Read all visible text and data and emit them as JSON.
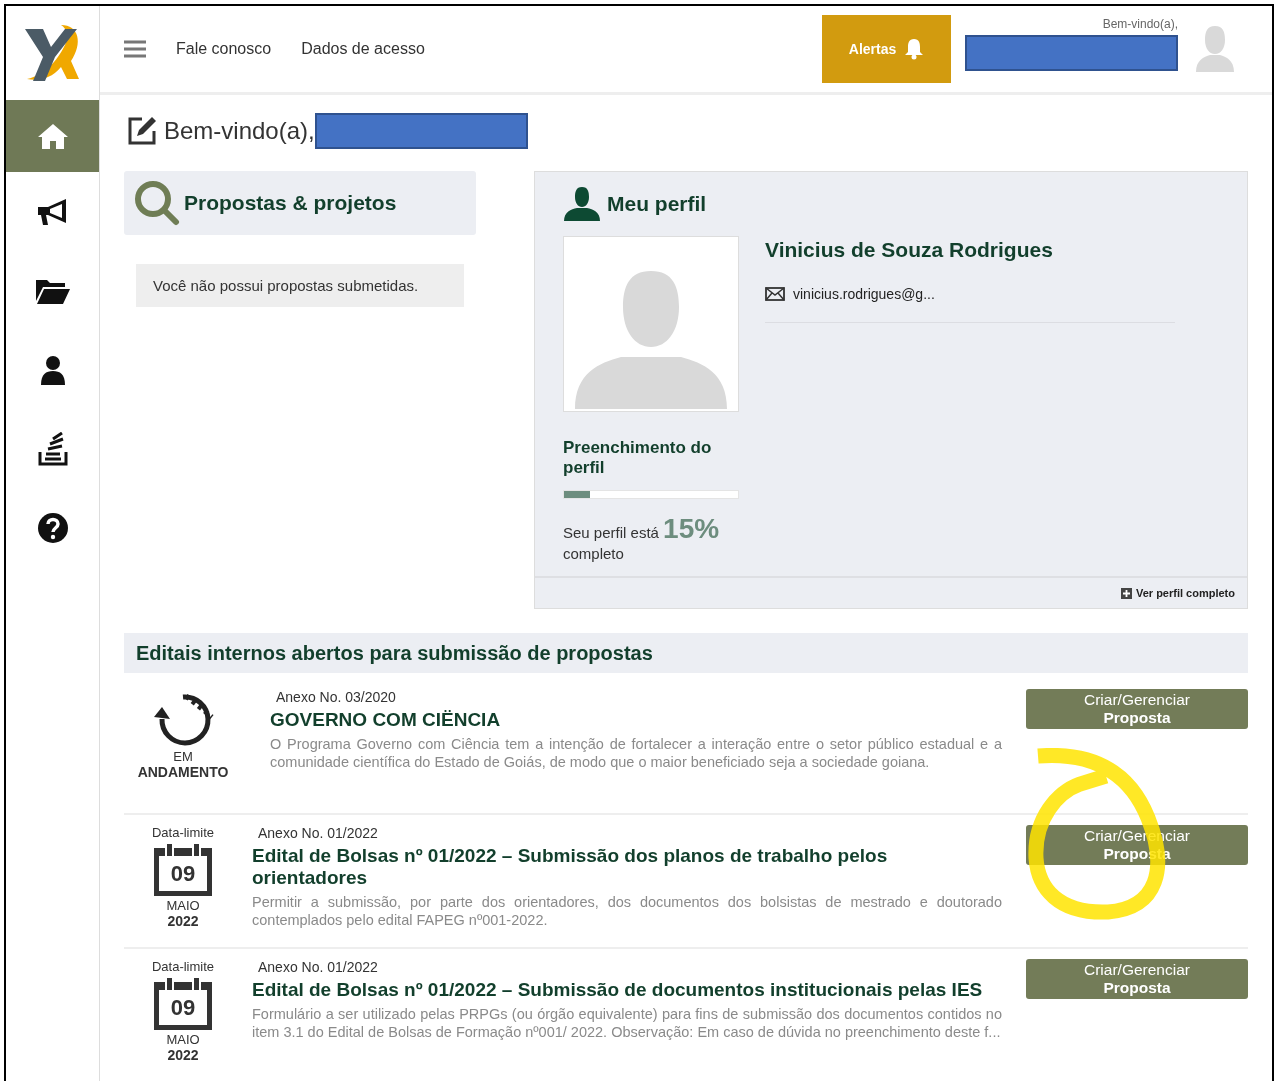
{
  "header": {
    "nav_links": [
      "Fale conosco",
      "Dados de acesso"
    ],
    "alerts_button": "Alertas",
    "greeting": "Bem-vindo(a),"
  },
  "sidebar": {
    "items": [
      {
        "selected": true
      },
      {
        "selected": false
      },
      {
        "selected": false
      },
      {
        "selected": false
      },
      {
        "selected": false
      },
      {
        "selected": false
      }
    ]
  },
  "page_title": "Bem-vindo(a),",
  "proposals": {
    "title": "Propostas & projetos",
    "empty_message": "Você não possui propostas submetidas."
  },
  "profile": {
    "title": "Meu perfil",
    "name": "Vinicius de Souza Rodrigues",
    "email": "vinicius.rodrigues@g...",
    "completion_title": "Preenchimento do perfil",
    "level": 0.15,
    "completion_prefix": "Seu perfil está",
    "completion_value": "15%",
    "completion_suffix": "completo",
    "view_full_link": "Ver perfil completo"
  },
  "calls": {
    "title": "Editais internos abertos para submissão de propostas",
    "items": [
      {
        "kind": "in_progress",
        "status_top": "EM",
        "status_bottom": "ANDAMENTO",
        "annex": "Anexo No. 03/2020",
        "title": "GOVERNO COM CIËNCIA",
        "description": "O Programa Governo com Ciência tem a intenção de fortalecer a interação entre o setor público estadual e a comunidade científica do Estado de Goiás, de modo que o maior beneficiado seja a sociedade goiana.",
        "button": "Criar/Gerenciar **Proposta**"
      },
      {
        "kind": "deadline",
        "deadline_label": "Data-limite",
        "day": "09",
        "month": "MAIO",
        "year": "2022",
        "annex": "Anexo No. 01/2022",
        "title": "Edital de Bolsas nº 01/2022 – Submissão dos planos de trabalho pelos orientadores",
        "description": "Permitir a submissão, por parte dos orientadores, dos documentos dos bolsistas de mestrado e doutorado contemplados pelo edital FAPEG nº001-2022.",
        "button": "Criar/Gerenciar **Proposta**"
      },
      {
        "kind": "deadline",
        "deadline_label": "Data-limite",
        "day": "09",
        "month": "MAIO",
        "year": "2022",
        "annex": "Anexo No. 01/2022",
        "title": "Edital de Bolsas nº 01/2022 – Submissão de documentos institucionais pelas IES",
        "description": "Formulário a ser utilizado pelas PRPGs (ou órgão equivalente) para fins de submissão dos documentos contidos no item 3.1 do Edital de Bolsas de Formação nº001/ 2022. Observação: Em caso de dúvida no preenchimento deste f...",
        "button": "Criar/Gerenciar **Proposta**"
      }
    ]
  }
}
